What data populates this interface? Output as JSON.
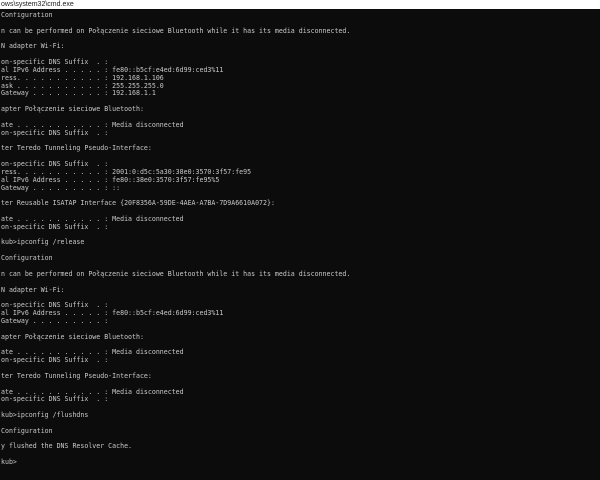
{
  "window": {
    "title": "ows\\system32\\cmd.exe"
  },
  "console": {
    "lines": [
      "Configuration",
      "",
      "n can be performed on Połączenie sieciowe Bluetooth while it has its media disconnected.",
      "",
      "N adapter Wi-Fi:",
      "",
      "on-specific DNS Suffix  . :",
      "al IPv6 Address . . . . . : fe80::b5cf:e4ed:6d99:ced3%11",
      "ress. . . . . . . . . . . : 192.168.1.106",
      "ask . . . . . . . . . . . : 255.255.255.0",
      "Gateway . . . . . . . . . : 192.168.1.1",
      "",
      "apter Połączenie sieciowe Bluetooth:",
      "",
      "ate . . . . . . . . . . . : Media disconnected",
      "on-specific DNS Suffix  . :",
      "",
      "ter Teredo Tunneling Pseudo-Interface:",
      "",
      "on-specific DNS Suffix  . :",
      "ress. . . . . . . . . . . : 2001:0:d5c:5a30:38e0:3570:3f57:fe95",
      "al IPv6 Address . . . . . : fe80::38e0:3570:3f57:fe95%5",
      "Gateway . . . . . . . . . : ::",
      "",
      "ter Reusable ISATAP Interface {20F8356A-59DE-4AEA-A7BA-7D9A6610A072}:",
      "",
      "ate . . . . . . . . . . . : Media disconnected",
      "on-specific DNS Suffix  . :",
      "",
      "kub>ipconfig /release",
      "",
      "Configuration",
      "",
      "n can be performed on Połączenie sieciowe Bluetooth while it has its media disconnected.",
      "",
      "N adapter Wi-Fi:",
      "",
      "on-specific DNS Suffix  . :",
      "al IPv6 Address . . . . . : fe80::b5cf:e4ed:6d99:ced3%11",
      "Gateway . . . . . . . . . :",
      "",
      "apter Połączenie sieciowe Bluetooth:",
      "",
      "ate . . . . . . . . . . . : Media disconnected",
      "on-specific DNS Suffix  . :",
      "",
      "ter Teredo Tunneling Pseudo-Interface:",
      "",
      "ate . . . . . . . . . . . : Media disconnected",
      "on-specific DNS Suffix  . :",
      "",
      "kub>ipconfig /flushdns",
      "",
      "Configuration",
      "",
      "y flushed the DNS Resolver Cache.",
      "",
      "kub>"
    ]
  }
}
